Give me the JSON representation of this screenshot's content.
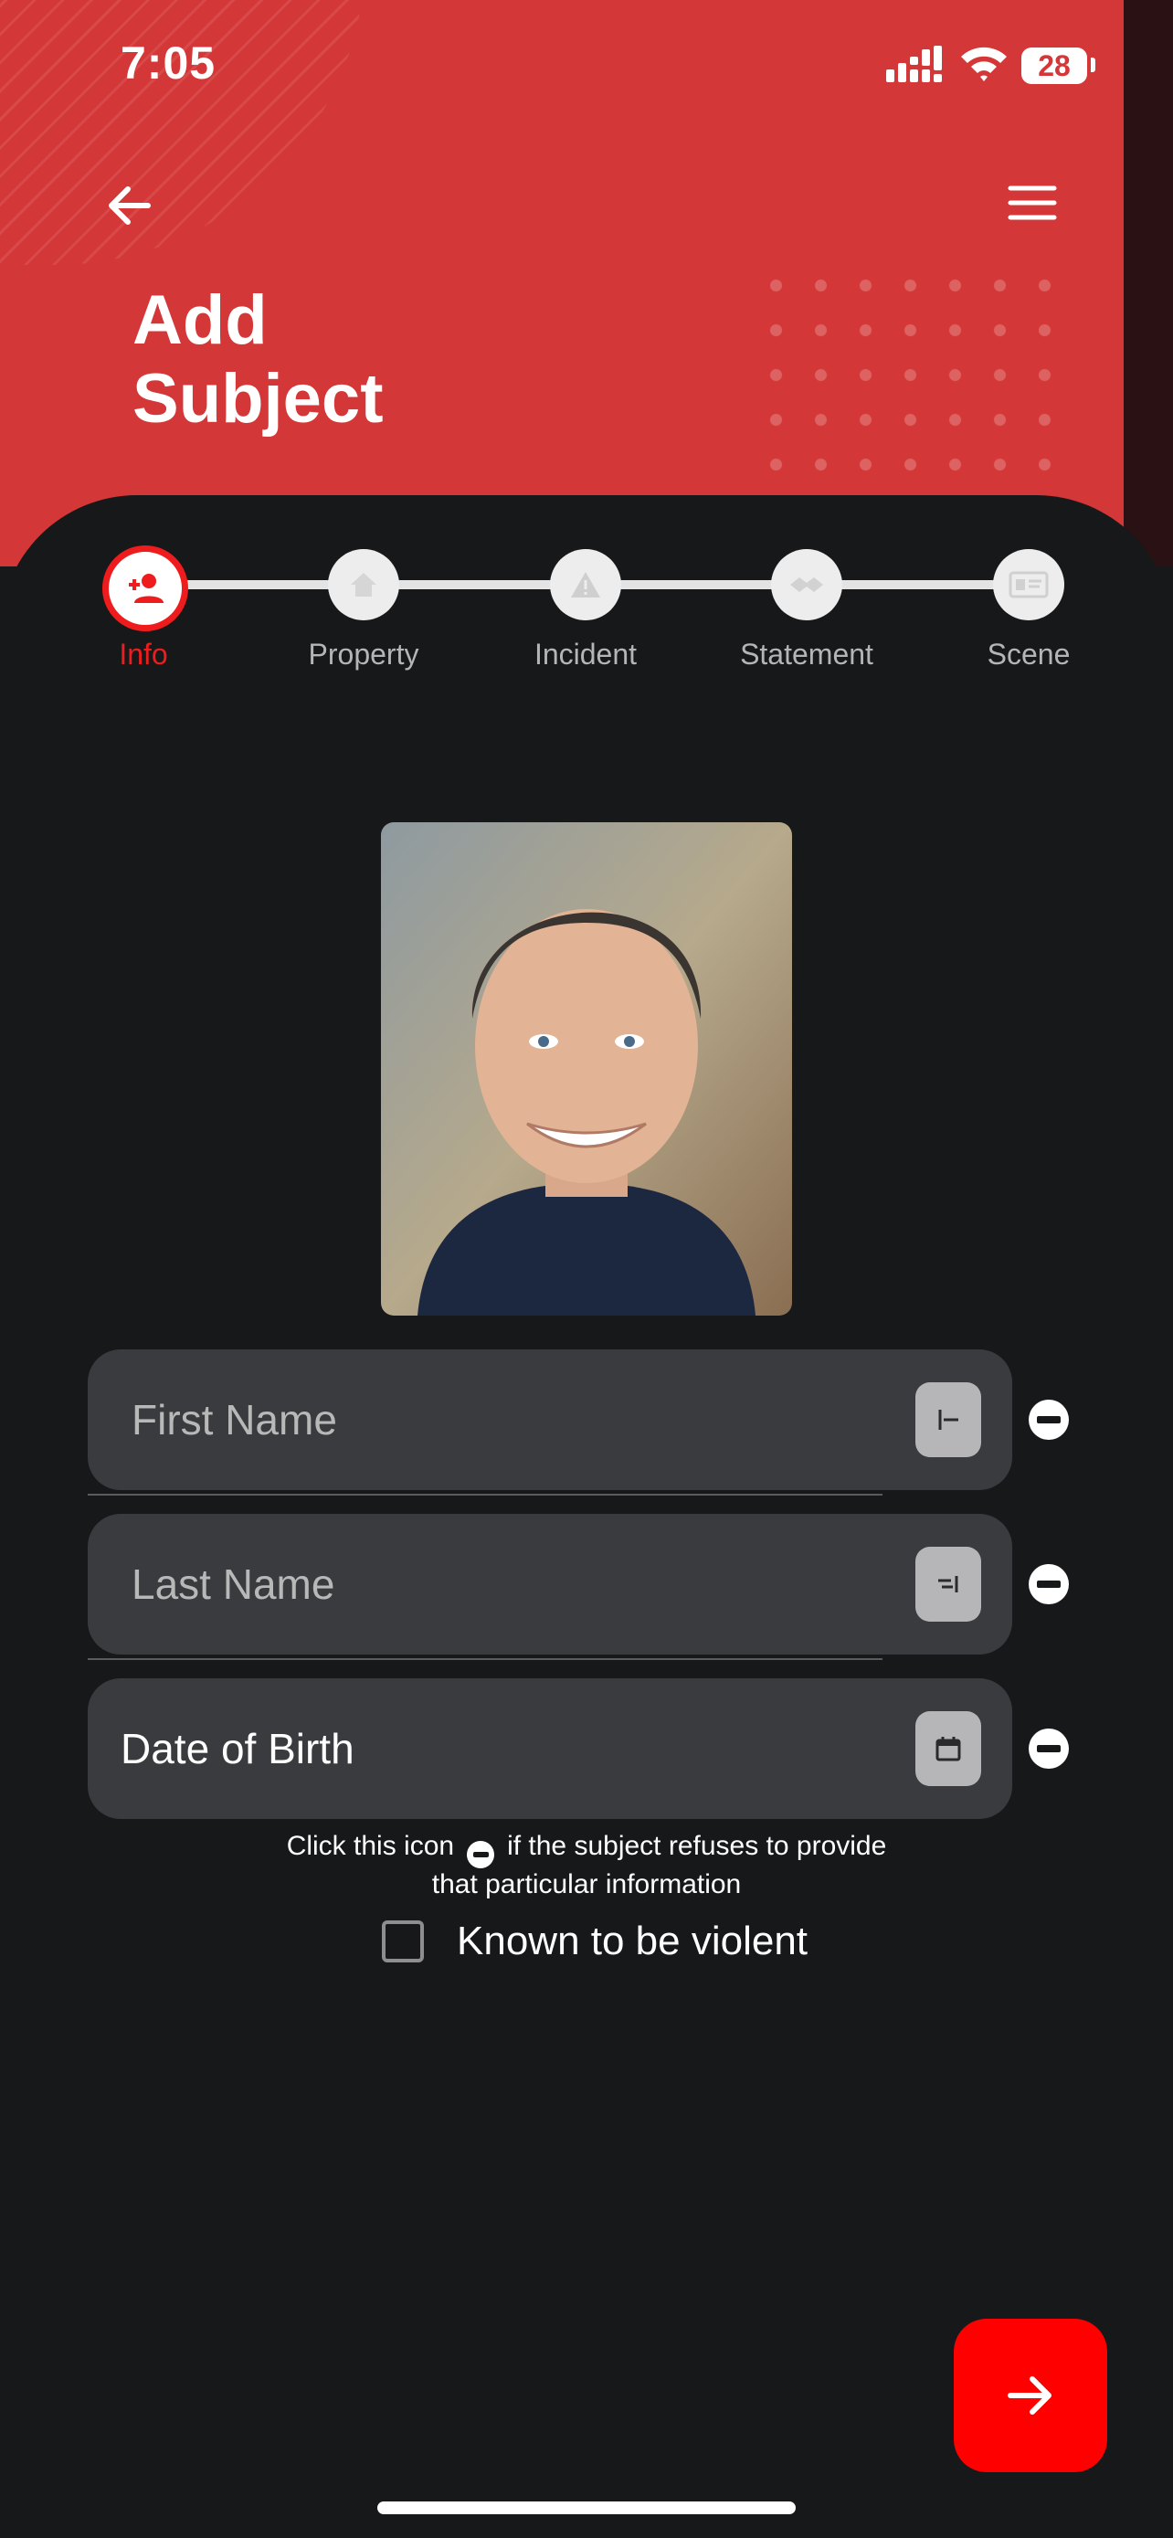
{
  "status_bar": {
    "time": "7:05",
    "battery": "28"
  },
  "header": {
    "title_line1": "Add",
    "title_line2": "Subject"
  },
  "stepper": {
    "steps": [
      {
        "label": "Info",
        "icon": "person-add-icon",
        "active": true
      },
      {
        "label": "Property",
        "icon": "home-icon",
        "active": false
      },
      {
        "label": "Incident",
        "icon": "warning-icon",
        "active": false
      },
      {
        "label": "Statement",
        "icon": "handshake-icon",
        "active": false
      },
      {
        "label": "Scene",
        "icon": "id-card-icon",
        "active": false
      }
    ]
  },
  "form": {
    "first_name": {
      "value": "",
      "placeholder": "First Name"
    },
    "last_name": {
      "value": "",
      "placeholder": "Last Name"
    },
    "dob": {
      "value": "Date of Birth",
      "placeholder": ""
    },
    "hint_before": "Click this icon",
    "hint_after": "if the subject refuses to provide",
    "hint_line2": "that particular information",
    "violent_label": "Known to be violent",
    "violent_checked": false
  },
  "colors": {
    "header": "#d43737",
    "accent": "#ee1c1c",
    "fab": "#fe0000",
    "background": "#17181a",
    "field": "#3a3b3e"
  }
}
